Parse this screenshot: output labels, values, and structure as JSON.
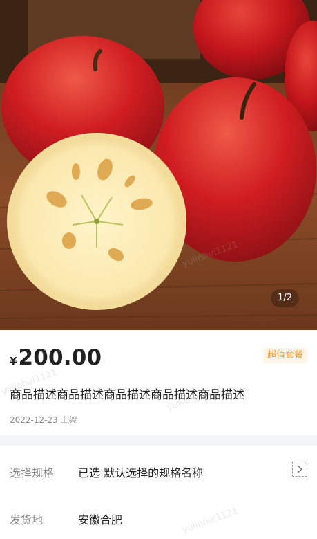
{
  "gallery": {
    "current_page": "1/2"
  },
  "product": {
    "currency_symbol": "¥",
    "price": "200.00",
    "badge": "超值套餐",
    "title": "商品描述商品描述商品描述商品描述商品描述",
    "listing_date": "2022-12-23 上架"
  },
  "spec": {
    "label": "选择规格",
    "value": "已选 默认选择的规格名称"
  },
  "shipping": {
    "label": "发货地",
    "value": "安徽合肥"
  },
  "watermark": "yulinhui1121",
  "colors": {
    "price": "#222222",
    "badge_text": "#f39c3a",
    "badge_bg": "#fff4e8",
    "label": "#8a8a8a",
    "separator": "#f4f5f7"
  }
}
